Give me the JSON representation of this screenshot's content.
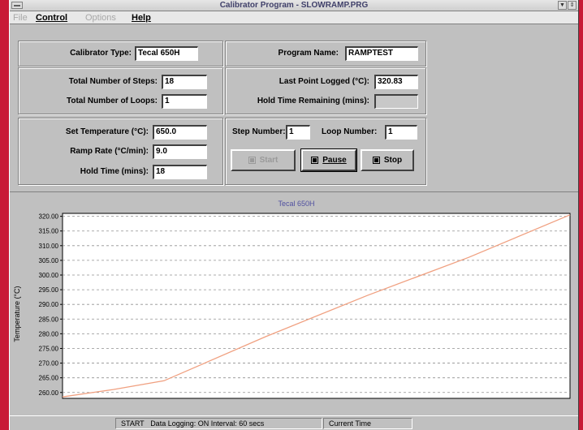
{
  "window": {
    "title": "Calibrator Program - SLOWRAMP.PRG",
    "controls": {
      "down": "▼",
      "restore": "⇕"
    }
  },
  "menubar": {
    "file": "File",
    "control": "Control",
    "options": "Options",
    "help": "Help"
  },
  "calibrator": {
    "type_label": "Calibrator Type:",
    "type_value": "Tecal 650H"
  },
  "program": {
    "name_label": "Program Name:",
    "name_value": "RAMPTEST"
  },
  "steps": {
    "total_steps_label": "Total Number of Steps:",
    "total_steps_value": "18",
    "total_loops_label": "Total Number of Loops:",
    "total_loops_value": "1"
  },
  "logging": {
    "last_point_label": "Last Point Logged (°C):",
    "last_point_value": "320.83",
    "hold_remaining_label": "Hold Time Remaining (mins):",
    "hold_remaining_value": ""
  },
  "setpoint": {
    "set_temp_label": "Set Temperature (°C):",
    "set_temp_value": "650.0",
    "ramp_rate_label": "Ramp Rate (°C/min):",
    "ramp_rate_value": "9.0",
    "hold_time_label": "Hold Time (mins):",
    "hold_time_value": "18"
  },
  "run": {
    "step_number_label": "Step Number:",
    "step_number_value": "1",
    "loop_number_label": "Loop Number:",
    "loop_number_value": "1",
    "start_label": "Start",
    "pause_label": "Pause",
    "stop_label": "Stop"
  },
  "status": {
    "state": "START",
    "data_logging": "Data Logging: ON  Interval: 60 secs",
    "current_time": "Current Time"
  },
  "colors": {
    "series": "#f0a080",
    "chart_title": "#5050a0",
    "background": "#c81a36"
  },
  "chart_data": {
    "type": "line",
    "title": "Tecal 650H",
    "xlabel": "",
    "ylabel": "Temperature (°C)",
    "ylim": [
      258,
      321
    ],
    "yticks": [
      "320.00",
      "315.00",
      "310.00",
      "305.00",
      "300.00",
      "295.00",
      "290.00",
      "285.00",
      "280.00",
      "275.00",
      "270.00",
      "265.00",
      "260.00"
    ],
    "grid": true,
    "series": [
      {
        "values_x": [
          0,
          0.1,
          0.2,
          0.4,
          0.6,
          0.8,
          1.0
        ],
        "values_y": [
          258.5,
          261.0,
          264.0,
          279.0,
          293.0,
          306.0,
          320.5
        ]
      }
    ]
  }
}
